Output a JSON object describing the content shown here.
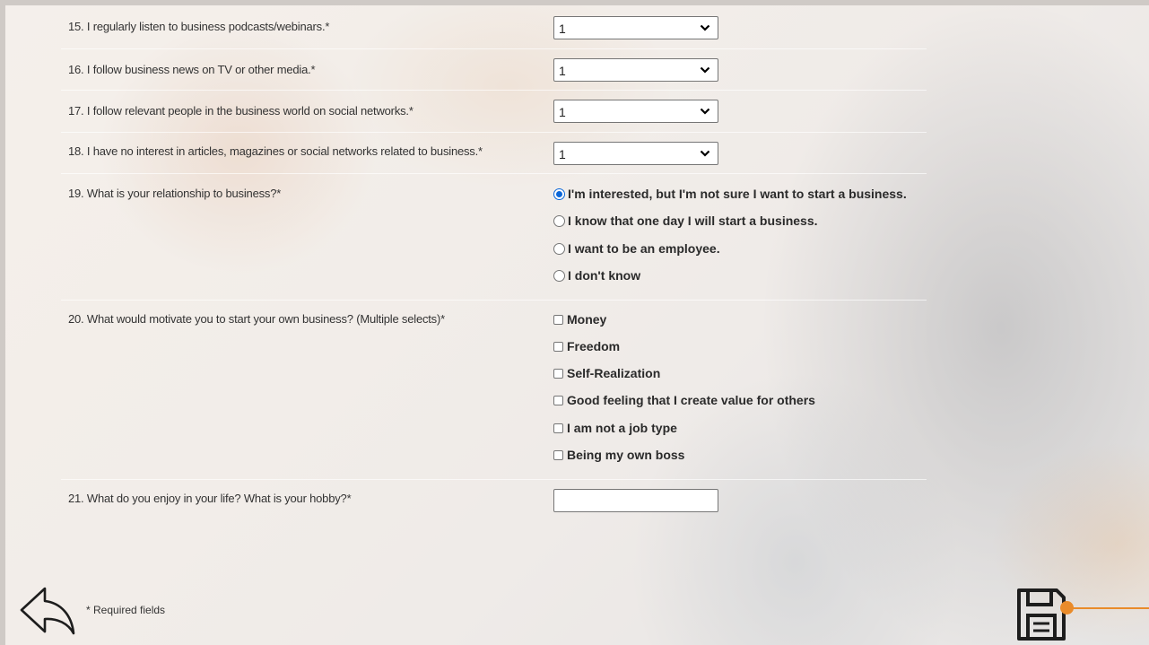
{
  "questions": {
    "q15": {
      "label": "15. I regularly listen to business podcasts/webinars.*",
      "value": "1"
    },
    "q16": {
      "label": "16. I follow business news on TV or other media.*",
      "value": "1"
    },
    "q17": {
      "label": "17. I follow relevant people in the business world on social networks.*",
      "value": "1"
    },
    "q18": {
      "label": "18. I have no interest in articles, magazines or social networks related to business.*",
      "value": "1"
    },
    "q19": {
      "label": "19. What is your relationship to business?*",
      "options": [
        "I'm interested, but I'm not sure I want to start a business.",
        "I know that one day I will start a business.",
        "I want to be an employee.",
        "I don't know"
      ],
      "selected_index": 0
    },
    "q20": {
      "label": "20. What would motivate you to start your own business? (Multiple selects)*",
      "options": [
        "Money",
        "Freedom",
        "Self-Realization",
        "Good feeling that I create value for others",
        "I am not a job type",
        "Being my own boss"
      ]
    },
    "q21": {
      "label": "21. What do you enjoy in your life? What is your hobby?*",
      "value": ""
    }
  },
  "footer": {
    "required_note": "* Required fields"
  },
  "icons": {
    "back": "back-arrow-icon",
    "save": "floppy-disk-icon"
  },
  "colors": {
    "accent": "#e98b2a",
    "radio_selected": "#0a66d8"
  }
}
